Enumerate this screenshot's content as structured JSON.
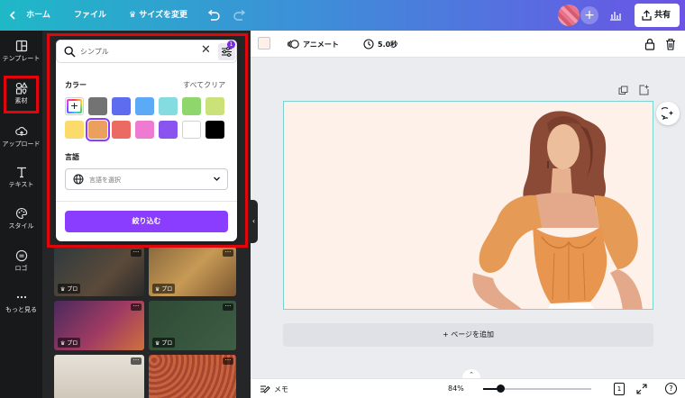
{
  "topbar": {
    "home_label": "ホーム",
    "file_label": "ファイル",
    "resize_label": "サイズを変更",
    "resize_prefix": "♛",
    "share_label": "共有"
  },
  "leftnav": {
    "items": [
      {
        "label": "テンプレート",
        "icon": "template-icon"
      },
      {
        "label": "素材",
        "icon": "elements-icon"
      },
      {
        "label": "アップロード",
        "icon": "upload-icon"
      },
      {
        "label": "テキスト",
        "icon": "text-icon"
      },
      {
        "label": "スタイル",
        "icon": "palette-icon"
      },
      {
        "label": "ロゴ",
        "icon": "logo-icon"
      },
      {
        "label": "もっと見る",
        "icon": "more-icon"
      }
    ]
  },
  "panel": {
    "search_value": "シンプル",
    "filter_count": "1",
    "color_label": "カラー",
    "clear_all": "すべてクリア",
    "colors": [
      "#737373",
      "#5e6cf0",
      "#5ba9f7",
      "#84dbe0",
      "#8fd66c",
      "#cbe27b",
      "#fadb6b",
      "#eca05e",
      "#eb6a63",
      "#ee7bd1",
      "#8a54ee",
      "#ffffff",
      "#000000"
    ],
    "selected_color": "#eca05e",
    "language_label": "言語",
    "language_placeholder": "言語を選択",
    "apply_label": "絞り込む",
    "pro_label": "プロ",
    "accent": "#8b3dff"
  },
  "editor": {
    "animate_label": "アニメート",
    "duration_label": "5.0秒",
    "add_page_label": "+ ページを追加",
    "notes_label": "メモ",
    "zoom_label": "84%",
    "page_number": "1",
    "help_label": "?",
    "canvas_bg": "#fdf1ea"
  }
}
